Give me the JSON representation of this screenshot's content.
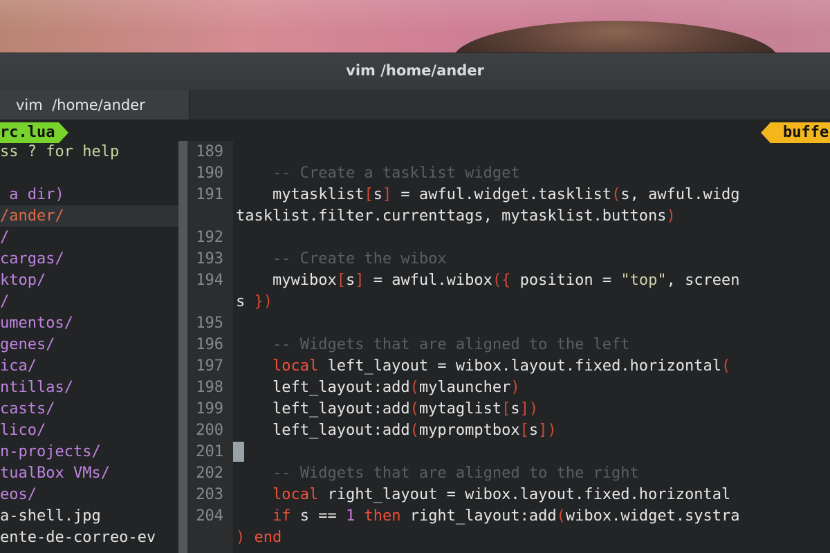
{
  "window": {
    "title": "vim  /home/ander"
  },
  "tab": {
    "label": "vim  /home/ander"
  },
  "nerdtree": {
    "buffer_label": "rc.lua",
    "help_text": "ss ? for help",
    "entries": [
      {
        "text": " a dir)",
        "kind": "help"
      },
      {
        "text": "/ander/",
        "kind": "root"
      },
      {
        "text": "/",
        "kind": "dir"
      },
      {
        "text": "cargas/",
        "kind": "dir"
      },
      {
        "text": "ktop/",
        "kind": "dir"
      },
      {
        "text": "/",
        "kind": "dir"
      },
      {
        "text": "umentos/",
        "kind": "dir"
      },
      {
        "text": "genes/",
        "kind": "dir"
      },
      {
        "text": "ica/",
        "kind": "dir"
      },
      {
        "text": "ntillas/",
        "kind": "dir"
      },
      {
        "text": "casts/",
        "kind": "dir"
      },
      {
        "text": "lico/",
        "kind": "dir"
      },
      {
        "text": "n-projects/",
        "kind": "dir"
      },
      {
        "text": "tualBox VMs/",
        "kind": "dir"
      },
      {
        "text": "eos/",
        "kind": "dir"
      },
      {
        "text": "a-shell.jpg",
        "kind": "file"
      },
      {
        "text": "ente-de-correo-ev",
        "kind": "file"
      }
    ]
  },
  "editor": {
    "buffer_tab_label": "buffe",
    "line_numbers": [
      "189",
      "190",
      "191",
      "",
      "192",
      "193",
      "194",
      "",
      "195",
      "196",
      "197",
      "198",
      "199",
      "200",
      "201",
      "202",
      "203",
      "204",
      ""
    ],
    "lines": [
      {
        "segments": []
      },
      {
        "segments": [
          {
            "t": "    -- Create a tasklist widget",
            "c": "cm"
          }
        ]
      },
      {
        "segments": [
          {
            "t": "    mytasklist",
            "c": "tx"
          },
          {
            "t": "[",
            "c": "br"
          },
          {
            "t": "s",
            "c": "tx"
          },
          {
            "t": "]",
            "c": "br"
          },
          {
            "t": " = awful.widget.tasklist",
            "c": "tx"
          },
          {
            "t": "(",
            "c": "br"
          },
          {
            "t": "s, awful.widg",
            "c": "tx"
          }
        ]
      },
      {
        "segments": [
          {
            "t": "tasklist.filter.currenttags, mytasklist.buttons",
            "c": "tx"
          },
          {
            "t": ")",
            "c": "br"
          }
        ]
      },
      {
        "segments": []
      },
      {
        "segments": [
          {
            "t": "    -- Create the wibox",
            "c": "cm"
          }
        ]
      },
      {
        "segments": [
          {
            "t": "    mywibox",
            "c": "tx"
          },
          {
            "t": "[",
            "c": "br"
          },
          {
            "t": "s",
            "c": "tx"
          },
          {
            "t": "]",
            "c": "br"
          },
          {
            "t": " = awful.wibox",
            "c": "tx"
          },
          {
            "t": "({",
            "c": "br"
          },
          {
            "t": " position = ",
            "c": "tx"
          },
          {
            "t": "\"top\"",
            "c": "st"
          },
          {
            "t": ", screen",
            "c": "tx"
          }
        ]
      },
      {
        "segments": [
          {
            "t": "s ",
            "c": "tx"
          },
          {
            "t": "})",
            "c": "br"
          }
        ]
      },
      {
        "segments": []
      },
      {
        "segments": [
          {
            "t": "    -- Widgets that are aligned to the left",
            "c": "cm"
          }
        ]
      },
      {
        "segments": [
          {
            "t": "    ",
            "c": "tx"
          },
          {
            "t": "local",
            "c": "kw"
          },
          {
            "t": " left_layout = wibox.layout.fixed.horizontal",
            "c": "tx"
          },
          {
            "t": "(",
            "c": "br"
          }
        ]
      },
      {
        "segments": [
          {
            "t": "    left_layout:add",
            "c": "tx"
          },
          {
            "t": "(",
            "c": "br"
          },
          {
            "t": "mylauncher",
            "c": "tx"
          },
          {
            "t": ")",
            "c": "br"
          }
        ]
      },
      {
        "segments": [
          {
            "t": "    left_layout:add",
            "c": "tx"
          },
          {
            "t": "(",
            "c": "br"
          },
          {
            "t": "mytaglist",
            "c": "tx"
          },
          {
            "t": "[",
            "c": "br"
          },
          {
            "t": "s",
            "c": "tx"
          },
          {
            "t": "])",
            "c": "br"
          }
        ]
      },
      {
        "segments": [
          {
            "t": "    left_layout:add",
            "c": "tx"
          },
          {
            "t": "(",
            "c": "br"
          },
          {
            "t": "mypromptbox",
            "c": "tx"
          },
          {
            "t": "[",
            "c": "br"
          },
          {
            "t": "s",
            "c": "tx"
          },
          {
            "t": "])",
            "c": "br"
          }
        ]
      },
      {
        "segments": []
      },
      {
        "segments": [
          {
            "t": "    -- Widgets that are aligned to the right",
            "c": "cm"
          }
        ]
      },
      {
        "segments": [
          {
            "t": "    ",
            "c": "tx"
          },
          {
            "t": "local",
            "c": "kw"
          },
          {
            "t": " right_layout = wibox.layout.fixed.horizontal",
            "c": "tx"
          }
        ]
      },
      {
        "segments": [
          {
            "t": "    ",
            "c": "tx"
          },
          {
            "t": "if",
            "c": "kw"
          },
          {
            "t": " s == ",
            "c": "tx"
          },
          {
            "t": "1",
            "c": "nm"
          },
          {
            "t": " ",
            "c": "tx"
          },
          {
            "t": "then",
            "c": "kw"
          },
          {
            "t": " right_layout:add",
            "c": "tx"
          },
          {
            "t": "(",
            "c": "br"
          },
          {
            "t": "wibox.widget.systra",
            "c": "tx"
          }
        ]
      },
      {
        "segments": [
          {
            "t": ")",
            "c": "br"
          },
          {
            "t": " ",
            "c": "tx"
          },
          {
            "t": "end",
            "c": "kw"
          }
        ]
      }
    ],
    "cursor_line": "201"
  },
  "colors": {
    "badge_left": "#78d32c",
    "badge_right": "#f3b71d",
    "comment": "#5b5f61",
    "keyword": "#f0503a",
    "bracket": "#ce4b37",
    "directory": "#c083e0",
    "background": "#222426"
  }
}
